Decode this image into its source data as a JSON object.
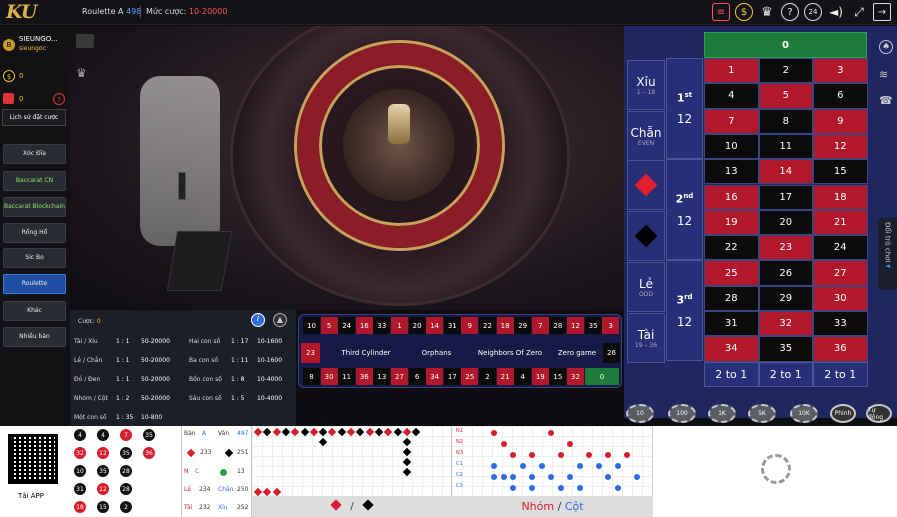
{
  "header": {
    "logo": "KU",
    "table_name": "Roulette A",
    "table_count": "498",
    "bet_label": "Mức cược:",
    "bet_range": "10-20000",
    "icons": [
      "bet-history-icon",
      "coin-icon",
      "trophy-icon",
      "help-icon",
      "24h-icon",
      "sound-icon",
      "fullscreen-icon",
      "exit-icon"
    ]
  },
  "user": {
    "name": "SIEUNGO...",
    "sub": "sieungoc",
    "balance": "0",
    "gift": "0",
    "history_btn": "Lịch sử đặt cược"
  },
  "nav": [
    "Xóc Đĩa",
    "Baccarat CN",
    "Baccarat Blockchain",
    "Rồng Hổ",
    "Sic Bo",
    "Roulette",
    "Khác",
    "Nhiều bàn"
  ],
  "board": {
    "zero": "0",
    "rows": [
      [
        "1",
        "2",
        "3"
      ],
      [
        "4",
        "5",
        "6"
      ],
      [
        "7",
        "8",
        "9"
      ],
      [
        "10",
        "11",
        "12"
      ],
      [
        "13",
        "14",
        "15"
      ],
      [
        "16",
        "17",
        "18"
      ],
      [
        "19",
        "20",
        "21"
      ],
      [
        "22",
        "23",
        "24"
      ],
      [
        "25",
        "26",
        "27"
      ],
      [
        "28",
        "29",
        "30"
      ],
      [
        "31",
        "32",
        "33"
      ],
      [
        "34",
        "35",
        "36"
      ]
    ],
    "red_numbers": [
      "1",
      "3",
      "5",
      "7",
      "9",
      "12",
      "14",
      "16",
      "18",
      "19",
      "21",
      "23",
      "25",
      "27",
      "30",
      "32",
      "34",
      "36"
    ],
    "two_to_one": [
      "2 to 1",
      "2 to 1",
      "2 to 1"
    ],
    "xiu": "Xỉu",
    "xiu_range": "1 – 18",
    "chan": "Chẵn",
    "chan_en": "EVEN",
    "le": "Lẻ",
    "le_en": "ODD",
    "tai": "Tài",
    "tai_range": "19 – 36",
    "dozens": [
      {
        "ord": "1",
        "sup": "st",
        "val": "12"
      },
      {
        "ord": "2",
        "sup": "nd",
        "val": "12"
      },
      {
        "ord": "3",
        "sup": "rd",
        "val": "12"
      }
    ],
    "change_table": "Đổi trò chơi"
  },
  "race": {
    "top": [
      "10",
      "5",
      "24",
      "16",
      "33",
      "1",
      "20",
      "14",
      "31",
      "9",
      "22",
      "18",
      "29",
      "7",
      "28",
      "12",
      "35",
      "3"
    ],
    "bottom": [
      "8",
      "30",
      "11",
      "36",
      "13",
      "27",
      "6",
      "34",
      "17",
      "25",
      "2",
      "21",
      "4",
      "19",
      "15",
      "32"
    ],
    "left": "23",
    "right": "26",
    "zero": "0",
    "sections": [
      "Third Cylinder",
      "Orphans",
      "Neighbors Of Zero",
      "Zero game"
    ]
  },
  "payouts": {
    "bet_label": "Cược:",
    "bet_value": "0",
    "left": [
      [
        "Tài / Xỉu",
        "1 : 1",
        "50-20000"
      ],
      [
        "Lẻ / Chẵn",
        "1 : 1",
        "50-20000"
      ],
      [
        "Đỏ / Đen",
        "1 : 1",
        "50-20000"
      ],
      [
        "Nhóm / Cột",
        "1 : 2",
        "50-20000"
      ],
      [
        "Một con số",
        "1 : 35",
        "10-800"
      ]
    ],
    "right": [
      [
        "Hai con số",
        "1 : 17",
        "10-1600"
      ],
      [
        "Ba con số",
        "1 : 11",
        "10-1600"
      ],
      [
        "Bốn con số",
        "1 : 8",
        "10-4000"
      ],
      [
        "Sáu con số",
        "1 : 5",
        "10-4000"
      ]
    ]
  },
  "chips": [
    "10",
    "100",
    "1K",
    "5K",
    "10K",
    "Phinh",
    "Tự động"
  ],
  "stats": {
    "ban": "Bàn",
    "a": "A",
    "van": "Ván",
    "van_val": "497",
    "red_count": "233",
    "black_count": "251",
    "n": "N",
    "c": "C",
    "zero_count": "13",
    "le": "Lẻ",
    "le_count": "234",
    "chan": "Chẵn",
    "chan_count": "250",
    "tai": "Tài",
    "tai_count": "232",
    "xiu": "Xỉu",
    "xiu_count": "252"
  },
  "history_balls": [
    [
      "4",
      "4",
      "7",
      "35"
    ],
    [
      "32",
      "12",
      "35",
      "36"
    ],
    [
      "10",
      "35",
      "28",
      ""
    ],
    [
      "31",
      "12",
      "28",
      ""
    ],
    [
      "18",
      "15",
      "2",
      ""
    ]
  ],
  "history_colors": [
    [
      "blk",
      "blk",
      "red",
      "blk"
    ],
    [
      "red",
      "red",
      "blk",
      "red"
    ],
    [
      "blk",
      "blk",
      "blk",
      ""
    ],
    [
      "blk",
      "red",
      "blk",
      ""
    ],
    [
      "red",
      "blk",
      "blk",
      ""
    ]
  ],
  "road1_footer": "/",
  "road2_footer": {
    "a": "Nhóm",
    "sep": "/",
    "b": "Cột"
  },
  "road2_labels": [
    "N1",
    "N2",
    "N3",
    "C1",
    "C2",
    "C3"
  ],
  "app": {
    "label": "Tải APP"
  }
}
